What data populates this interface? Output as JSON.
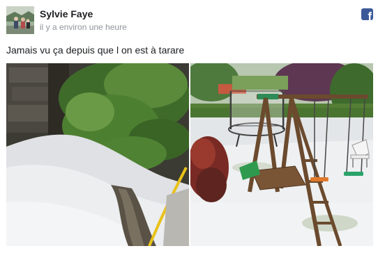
{
  "post": {
    "author": "Sylvie Faye",
    "timestamp": "il y a environ une heure",
    "message": "Jamais vu ça depuis que l on est à tarare",
    "brand_icon": "facebook-icon",
    "brand_color": "#3b5998"
  },
  "photos": [
    {
      "subject": "hail-covered-ground-with-shrub-and-hose"
    },
    {
      "subject": "hail-covered-garden-with-swing-set-and-trampoline"
    }
  ]
}
